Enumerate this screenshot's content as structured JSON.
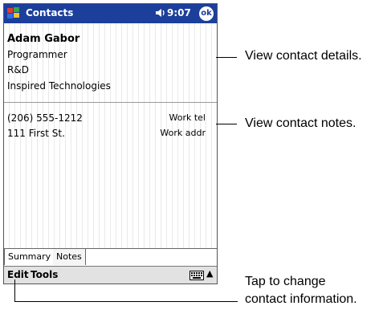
{
  "titlebar": {
    "app_title": "Contacts",
    "clock": "9:07",
    "ok_label": "ok"
  },
  "contact": {
    "name": "Adam Gabor",
    "title": "Programmer",
    "department": "R&D",
    "company": "Inspired Technologies",
    "fields": [
      {
        "value": "(206) 555-1212",
        "label": "Work tel"
      },
      {
        "value": "111 First St.",
        "label": "Work addr"
      }
    ]
  },
  "tabs": [
    "Summary",
    "Notes"
  ],
  "menu": {
    "edit": "Edit",
    "tools": "Tools",
    "kbd_toggle": "▲"
  },
  "callouts": {
    "details": "View contact details.",
    "notes": "View contact notes.",
    "change_line1": "Tap to change",
    "change_line2": "contact information."
  },
  "colors": {
    "titlebar": "#1c3f9c",
    "command_bar": "#e2e2e2"
  },
  "icons": {
    "start": "windows-flag-icon",
    "volume": "speaker-icon",
    "ok": "ok-button",
    "input": "keyboard-icon"
  }
}
